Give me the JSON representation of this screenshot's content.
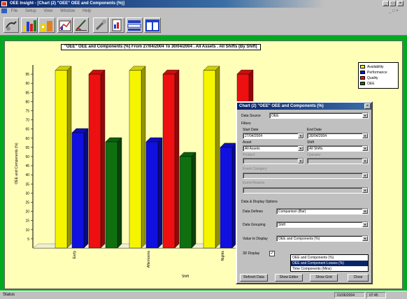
{
  "window": {
    "title": "OEE Insight - [Chart (2) \"OEE\" OEE and Components (%)]"
  },
  "menu": [
    "File",
    "Setup",
    "View",
    "Window",
    "Help"
  ],
  "toolbar": {
    "icons": [
      "connect-icon",
      "bar-chart-icon",
      "factory-chart-icon",
      "trend-chart-icon",
      "chart-edit-icon",
      "tools-icon",
      "report-icon",
      "layout-icon",
      "columns-icon"
    ]
  },
  "chart_data": {
    "type": "bar",
    "title": "\"OEE\" OEE and Components (%) From 27/04/2004 To 30/04/2004 . All Assets . All Shifts (By Shift)",
    "xlabel": "Shift",
    "ylabel": "OEE and Components (%)",
    "ylim": [
      0,
      100
    ],
    "yticks": [
      5,
      10,
      15,
      20,
      25,
      30,
      35,
      40,
      45,
      50,
      55,
      60,
      65,
      70,
      75,
      80,
      85,
      90,
      95
    ],
    "categories": [
      "Early",
      "Afternoons",
      "Nights"
    ],
    "series": [
      {
        "name": "Availability",
        "color": "#f5f500",
        "values": [
          97,
          97,
          97
        ]
      },
      {
        "name": "Performance",
        "color": "#1010e0",
        "values": [
          63,
          58,
          55
        ]
      },
      {
        "name": "Quality",
        "color": "#ee1010",
        "values": [
          95,
          95,
          95
        ]
      },
      {
        "name": "OEE",
        "color": "#107010",
        "values": [
          58,
          50,
          null
        ]
      }
    ],
    "grid": false,
    "legend": "top-right",
    "style": "3d"
  },
  "dialog": {
    "title": "Chart (2) \"OEE\" OEE and Components (%)",
    "data_source_label": "Data Source",
    "data_source_value": "OEE",
    "filters_label": "Filters",
    "start_date_label": "Start Date",
    "start_date_value": "27/04/2004",
    "end_date_label": "End Date",
    "end_date_value": "30/04/2004",
    "asset_label": "Asset",
    "asset_value": "All Assets",
    "shift_label": "Shift",
    "shift_value": "All Shifts",
    "product_label": "Product",
    "operator_label": "Operator",
    "event_category_label": "Event Category",
    "event_reason_label": "Event Reason",
    "display_options_label": "Data & Display Options",
    "data_defines_label": "Data Defines",
    "data_defines_value": "Comparison (Bar)",
    "data_grouping_label": "Data Grouping",
    "data_grouping_value": "Shift",
    "value_to_display_label": "Value to Display",
    "value_to_display_value": "OEE and Components (%)",
    "threed_display_label": "3D Display",
    "dropdown_options": [
      "OEE and Components (%)",
      "OEE and Component Losses (%)",
      "Time Components (Mins)"
    ],
    "dropdown_selected_index": 1,
    "buttons": {
      "refresh": "Refresh Data",
      "show_editor": "Show Editor",
      "show_grid": "Show Grid",
      "close": "Close"
    }
  },
  "status": {
    "text": "Status",
    "date": "01/06/2004",
    "time": "07:45"
  }
}
